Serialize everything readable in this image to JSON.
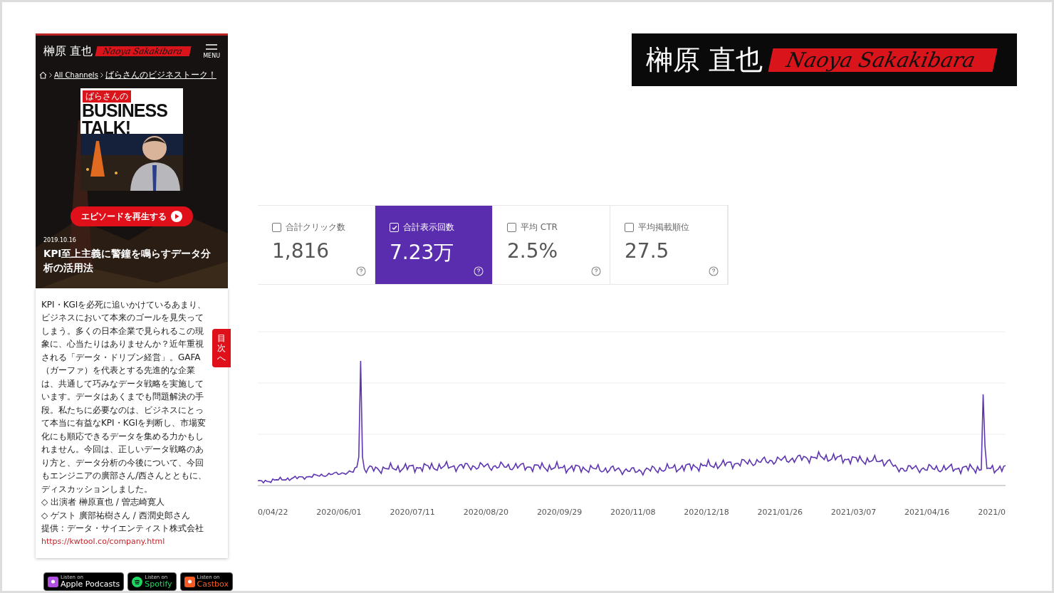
{
  "phone": {
    "logo": {
      "kanji": "榊原 直也",
      "script": "Naoya Sakakibara"
    },
    "menu_label": "MENU",
    "breadcrumb": [
      "All Channels",
      "ばらさんのビジネストーク！"
    ],
    "cover": {
      "tag": "ばらさんの",
      "title_lines": [
        "BUSINESS",
        "TALK!"
      ]
    },
    "play_button": "エピソードを再生する",
    "date": "2019.10.16",
    "title": "KPI至上主義に警鐘を鳴らすデータ分析の活用法",
    "description": "KPI・KGIを必死に追いかけているあまり、ビジネスにおいて本来のゴールを見失ってしまう。多くの日本企業で見られるこの現象に、心当たりはありませんか？近年重視される「データ・ドリブン経営」。GAFA（ガーファ）を代表とする先進的な企業は、共通して巧みなデータ戦略を実施しています。データはあくまでも問題解決の手段。私たちに必要なのは、ビジネスにとって本当に有益なKPI・KGIを判断し、市場変化にも順応できるデータを集める力かもしれません。今回は、正しいデータ戦略のあり方と、データ分析の今後について、今回もエンジニアの廣部さん/西さんとともに、ディスカッションしました。",
    "credits": [
      "◇ 出演者 榊原直也 / 曽志崎寛人",
      "◇ ゲスト 廣部祐樹さん / 西潤史郎さん",
      "提供 : データ・サイエンティスト株式会社"
    ],
    "link": "https://kwtool.co/company.html",
    "toc_tab": "目次へ",
    "badges": [
      {
        "kind": "apple",
        "small": "Listen on",
        "name": "Apple Podcasts"
      },
      {
        "kind": "spotify",
        "small": "Listen on",
        "name": "Spotify"
      },
      {
        "kind": "castbox",
        "small": "Listen on",
        "name": "Castbox"
      }
    ]
  },
  "banner": {
    "kanji": "榊原 直也",
    "script": "Naoya Sakakibara"
  },
  "metrics": [
    {
      "label": "合計クリック数",
      "value": "1,816",
      "selected": false
    },
    {
      "label": "合計表示回数",
      "value": "7.23万",
      "selected": true
    },
    {
      "label": "平均 CTR",
      "value": "2.5%",
      "selected": false
    },
    {
      "label": "平均掲載順位",
      "value": "27.5",
      "selected": false
    }
  ],
  "chart": {
    "x_labels": [
      "0/04/22",
      "2020/06/01",
      "2020/07/11",
      "2020/08/20",
      "2020/09/29",
      "2020/11/08",
      "2020/12/18",
      "2021/01/26",
      "2021/03/07",
      "2021/04/16",
      "2021/0"
    ]
  }
}
